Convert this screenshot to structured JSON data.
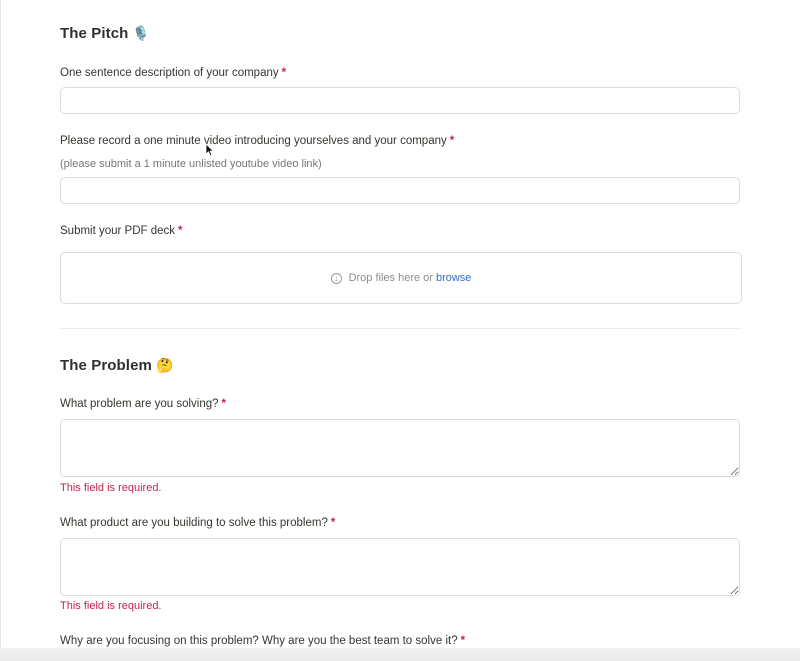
{
  "pitch": {
    "title": "The Pitch",
    "title_emoji": "🎙️",
    "q1_label": "One sentence description of your company",
    "q1_value": "",
    "q2_label": "Please record a one minute video introducing yourselves and your company",
    "q2_hint": "(please submit a 1 minute unlisted youtube video link)",
    "q2_value": "",
    "q3_label": "Submit your PDF deck",
    "dropzone_text": "Drop files here or",
    "dropzone_link": "browse"
  },
  "problem": {
    "title": "The Problem",
    "title_emoji": "🤔",
    "q1_label": "What problem are you solving?",
    "q1_error": "This field is required.",
    "q2_label": "What product are you building to solve this problem?",
    "q2_error": "This field is required.",
    "q3_label": "Why are you focusing on this problem? Why are you the best team to solve it?"
  },
  "required_marker": "*",
  "colors": {
    "required": "#c4244e",
    "link": "#2f6fd1",
    "error": "#c4244e"
  }
}
